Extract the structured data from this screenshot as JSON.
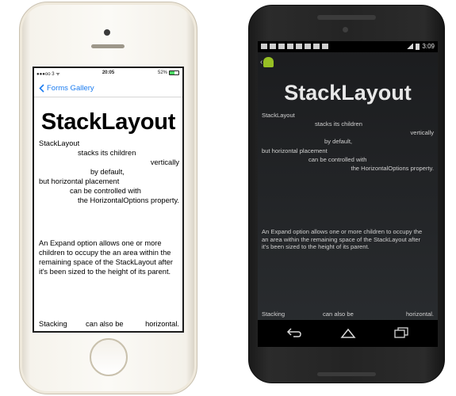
{
  "ios": {
    "status": {
      "carrier": "●●●oo 3 ᯤ",
      "time": "20:05",
      "battery": "52%"
    },
    "nav": {
      "back_label": "Forms Gallery"
    },
    "title": "StackLayout",
    "lines": [
      "StackLayout",
      "stacks its children",
      "vertically",
      "by default,",
      "but horizontal placement",
      "can be controlled with",
      "the HorizontalOptions property."
    ],
    "paragraph": "An Expand option allows one or more children to occupy the an area within the remaining space of the StackLayout after it's been sized to the height of its parent.",
    "bottom": [
      "Stacking",
      "can also be",
      "horizontal."
    ]
  },
  "android": {
    "status": {
      "time": "3:09"
    },
    "title": "StackLayout",
    "lines": [
      "StackLayout",
      "stacks its children",
      "vertically",
      "by default,",
      "but horizontal placement",
      "can be controlled with",
      "the HorizontalOptions property."
    ],
    "paragraph": "An Expand option allows one or more children to occupy the an area within the remaining space of the StackLayout after it's been sized to the height of its parent.",
    "bottom": [
      "Stacking",
      "can also be",
      "horizontal."
    ]
  },
  "colors": {
    "ios_accent": "#1a7bf0",
    "android_logo": "#97c024"
  }
}
